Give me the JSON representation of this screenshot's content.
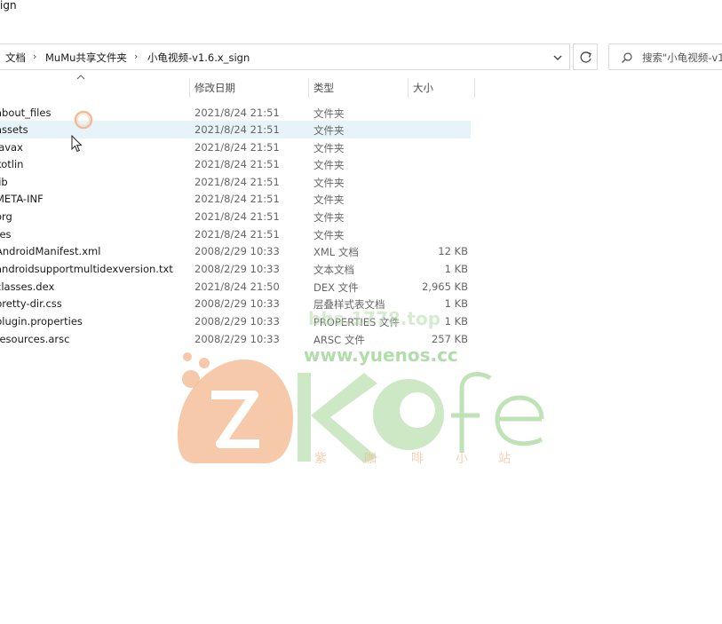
{
  "window": {
    "title_fragment": "ign"
  },
  "breadcrumb": {
    "items": [
      {
        "label": "文档"
      },
      {
        "label": "MuMu共享文件夹"
      },
      {
        "label": "小龟视频-v1.6.x_sign"
      }
    ],
    "separator": "›"
  },
  "search": {
    "placeholder": "搜索\"小龟视频-v1"
  },
  "columns": {
    "name_sort_indicator": "^",
    "date": "修改日期",
    "type": "类型",
    "size": "大小"
  },
  "files": [
    {
      "name": "about_files",
      "date": "2021/8/24 21:51",
      "type": "文件夹",
      "size": ""
    },
    {
      "name": "assets",
      "date": "2021/8/24 21:51",
      "type": "文件夹",
      "size": ""
    },
    {
      "name": "javax",
      "date": "2021/8/24 21:51",
      "type": "文件夹",
      "size": ""
    },
    {
      "name": "kotlin",
      "date": "2021/8/24 21:51",
      "type": "文件夹",
      "size": ""
    },
    {
      "name": "lib",
      "date": "2021/8/24 21:51",
      "type": "文件夹",
      "size": ""
    },
    {
      "name": "META-INF",
      "date": "2021/8/24 21:51",
      "type": "文件夹",
      "size": ""
    },
    {
      "name": "org",
      "date": "2021/8/24 21:51",
      "type": "文件夹",
      "size": ""
    },
    {
      "name": "res",
      "date": "2021/8/24 21:51",
      "type": "文件夹",
      "size": ""
    },
    {
      "name": "AndroidManifest.xml",
      "date": "2008/2/29 10:33",
      "type": "XML 文档",
      "size": "12 KB"
    },
    {
      "name": "androidsupportmultidexversion.txt",
      "date": "2008/2/29 10:33",
      "type": "文本文档",
      "size": "1 KB"
    },
    {
      "name": "classes.dex",
      "date": "2021/8/24 21:50",
      "type": "DEX 文件",
      "size": "2,965 KB"
    },
    {
      "name": "pretty-dir.css",
      "date": "2008/2/29 10:33",
      "type": "层叠样式表文档",
      "size": "1 KB"
    },
    {
      "name": "plugin.properties",
      "date": "2008/2/29 10:33",
      "type": "PROPERTIES 文件",
      "size": "1 KB"
    },
    {
      "name": "resources.arsc",
      "date": "2008/2/29 10:33",
      "type": "ARSC 文件",
      "size": "257 KB"
    }
  ],
  "watermark": {
    "line1": "bbs.1778.top",
    "line2": "www.yuenos.cc",
    "logo_text": "Kofe",
    "cn_chars": [
      "紫",
      "咖",
      "啡",
      "小",
      "站"
    ]
  },
  "colors": {
    "selection": "#e6f3f8",
    "border": "#d9d9d9",
    "logo_orange": "#f0b98a",
    "logo_green": "#b9e0b0"
  }
}
